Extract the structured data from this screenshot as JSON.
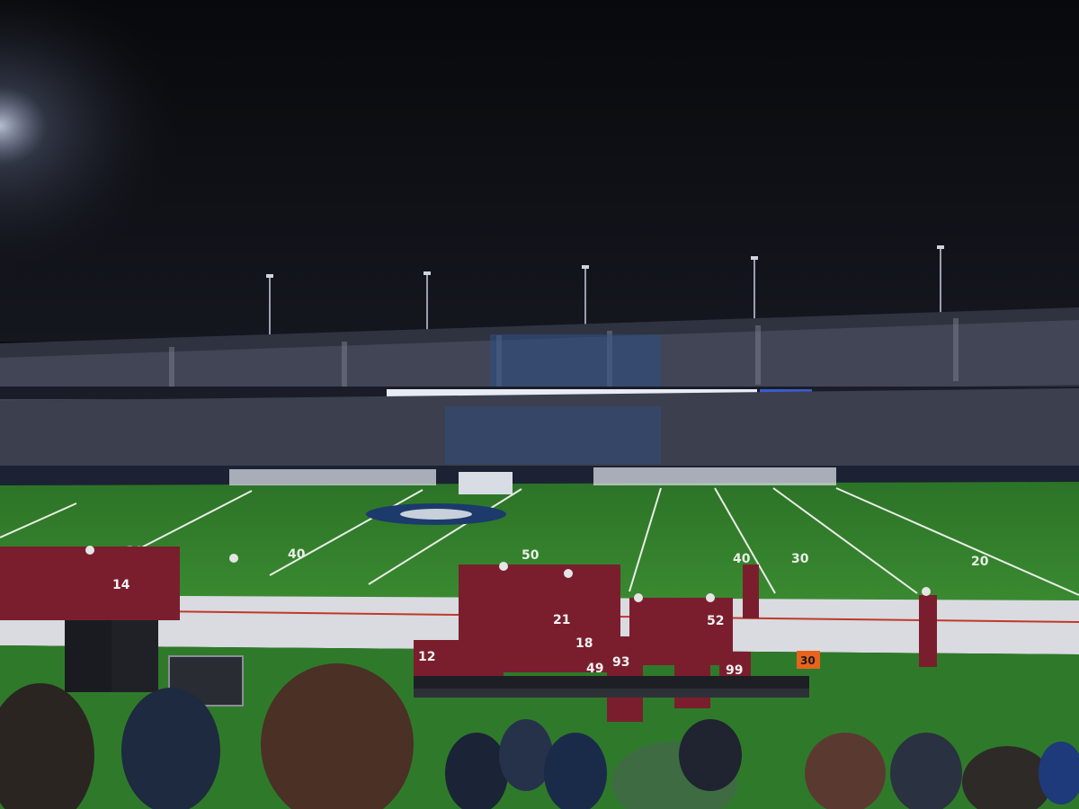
{
  "scene": {
    "kind": "photograph",
    "subject": "night college football game viewed from the stands behind the home sideline"
  },
  "field": {
    "yard_numbers": [
      "30",
      "40",
      "50",
      "40",
      "30",
      "20"
    ],
    "sideline_marker": "30"
  },
  "jerseys": [
    "12",
    "93",
    "99",
    "52",
    "21",
    "18",
    "14",
    "49"
  ],
  "palette": {
    "sky": "#0d0e12",
    "turf": "#2f7a2a",
    "turf_dark": "#266b22",
    "maroon": "#7a1e2e",
    "white_team": "#d8dce4",
    "stands": "#3a3f4c"
  },
  "icons": [
    "stadium-light-icon"
  ]
}
